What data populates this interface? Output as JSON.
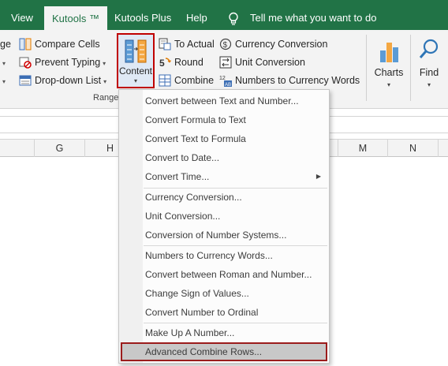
{
  "tabs": [
    {
      "label": "View",
      "active": false
    },
    {
      "label": "Kutools ™",
      "active": true
    },
    {
      "label": "Kutools Plus",
      "active": false
    },
    {
      "label": "Help",
      "active": false
    }
  ],
  "tell_me": "Tell me what you want to do",
  "ribbon": {
    "left_partial": [
      "ge",
      "",
      ""
    ],
    "col1": [
      "Compare Cells",
      "Prevent Typing",
      "Drop-down List"
    ],
    "col2": [
      "To Actual",
      "Round",
      "Combine"
    ],
    "col3": [
      "Currency Conversion",
      "Unit Conversion",
      "Numbers to Currency Words"
    ],
    "content_button": "Content",
    "charts_button": "Charts",
    "find_button": "Find",
    "group_label": "Range"
  },
  "columns": [
    "G",
    "H",
    "M",
    "N"
  ],
  "menu": {
    "items": [
      "Convert between Text and Number...",
      "Convert Formula to Text",
      "Convert Text to Formula",
      "Convert to Date...",
      "Convert Time...",
      "Currency Conversion...",
      "Unit Conversion...",
      "Conversion of Number Systems...",
      "Numbers to Currency Words...",
      "Convert between Roman and Number...",
      "Change Sign of Values...",
      "Convert Number to Ordinal",
      "Make Up A Number...",
      "Advanced Combine Rows..."
    ],
    "highlighted": "Advanced Combine Rows..."
  },
  "colors": {
    "accent": "#217346",
    "highlight_border": "#c00000"
  },
  "icons": [
    "lightbulb-icon",
    "compare-cells-icon",
    "prevent-typing-icon",
    "dropdown-list-icon",
    "to-actual-icon",
    "round-icon",
    "combine-icon",
    "currency-conversion-icon",
    "unit-conversion-icon",
    "numbers-to-currency-words-icon",
    "content-icon",
    "charts-icon",
    "find-icon"
  ]
}
